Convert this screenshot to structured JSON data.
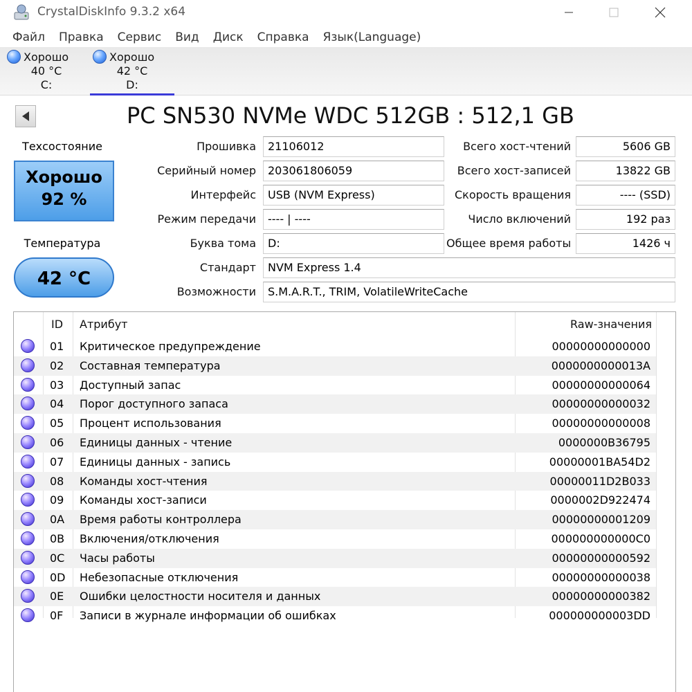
{
  "window": {
    "title": "CrystalDiskInfo 9.3.2 x64",
    "icons": {
      "app": "crystal-disk-icon",
      "minimize": "minimize-icon",
      "maximize": "maximize-icon",
      "close": "close-icon"
    }
  },
  "menu": [
    "Файл",
    "Правка",
    "Сервис",
    "Вид",
    "Диск",
    "Справка",
    "Язык(Language)"
  ],
  "disks": [
    {
      "status": "Хорошо",
      "temp": "40 °C",
      "letter": "C:"
    },
    {
      "status": "Хорошо",
      "temp": "42 °C",
      "letter": "D:"
    }
  ],
  "model": "PC SN530 NVMe WDC 512GB : 512,1 GB",
  "health": {
    "label": "Техсостояние",
    "status": "Хорошо",
    "percent": "92 %"
  },
  "temperature": {
    "label": "Температура",
    "value": "42 °C"
  },
  "info_left": [
    {
      "label": "Прошивка",
      "value": "21106012"
    },
    {
      "label": "Серийный номер",
      "value": "203061806059"
    },
    {
      "label": "Интерфейс",
      "value": "USB (NVM Express)"
    },
    {
      "label": "Режим передачи",
      "value": "---- | ----"
    },
    {
      "label": "Буква тома",
      "value": "D:"
    }
  ],
  "info_right": [
    {
      "label": "Всего хост-чтений",
      "value": "5606 GB"
    },
    {
      "label": "Всего хост-записей",
      "value": "13822 GB"
    },
    {
      "label": "Скорость вращения",
      "value": "---- (SSD)"
    },
    {
      "label": "Число включений",
      "value": "192 раз"
    },
    {
      "label": "Общее время работы",
      "value": "1426 ч"
    }
  ],
  "info_wide": [
    {
      "label": "Стандарт",
      "value": "NVM Express 1.4"
    },
    {
      "label": "Возможности",
      "value": "S.M.A.R.T., TRIM, VolatileWriteCache"
    }
  ],
  "smart": {
    "headers": {
      "id": "ID",
      "attr": "Атрибут",
      "raw": "Raw-значения"
    },
    "rows": [
      {
        "id": "01",
        "attr": "Критическое предупреждение",
        "raw": "00000000000000"
      },
      {
        "id": "02",
        "attr": "Составная температура",
        "raw": "0000000000013A"
      },
      {
        "id": "03",
        "attr": "Доступный запас",
        "raw": "00000000000064"
      },
      {
        "id": "04",
        "attr": "Порог доступного запаса",
        "raw": "00000000000032"
      },
      {
        "id": "05",
        "attr": "Процент использования",
        "raw": "00000000000008"
      },
      {
        "id": "06",
        "attr": "Единицы данных - чтение",
        "raw": "0000000B36795"
      },
      {
        "id": "07",
        "attr": "Единицы данных - запись",
        "raw": "00000001BA54D2"
      },
      {
        "id": "08",
        "attr": "Команды хост-чтения",
        "raw": "00000011D2B033"
      },
      {
        "id": "09",
        "attr": "Команды хост-записи",
        "raw": "0000002D922474"
      },
      {
        "id": "0A",
        "attr": "Время работы контроллера",
        "raw": "00000000001209"
      },
      {
        "id": "0B",
        "attr": "Включения/отключения",
        "raw": "000000000000C0"
      },
      {
        "id": "0C",
        "attr": "Часы работы",
        "raw": "00000000000592"
      },
      {
        "id": "0D",
        "attr": "Небезопасные отключения",
        "raw": "00000000000038"
      },
      {
        "id": "0E",
        "attr": "Ошибки целостности носителя и данных",
        "raw": "00000000000382"
      },
      {
        "id": "0F",
        "attr": "Записи в журнале информации об ошибках",
        "raw": "000000000003DD"
      }
    ]
  },
  "colors": {
    "accent": "#3b3bd8",
    "good": "#4d9ee8"
  }
}
